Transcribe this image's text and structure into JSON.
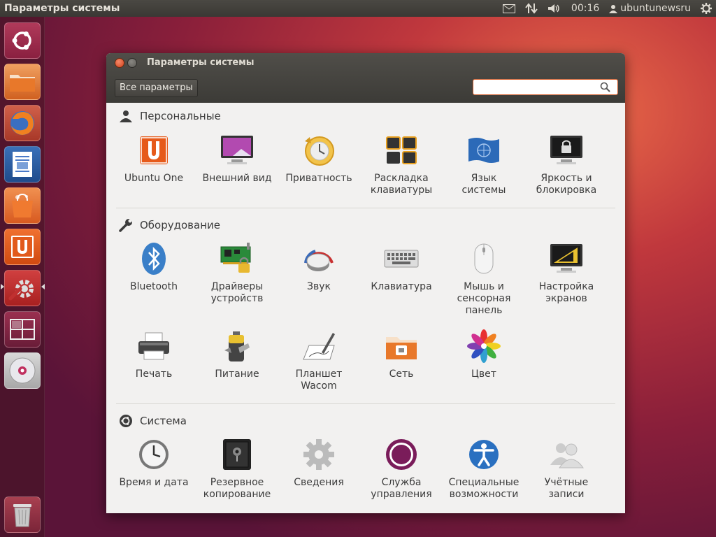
{
  "top_panel": {
    "app_title": "Параметры системы",
    "clock": "00:16",
    "user": "ubuntunewsru"
  },
  "launcher": {
    "items": [
      "dash-home",
      "files",
      "firefox",
      "libreoffice-writer",
      "ubuntu-software-center",
      "ubuntu-one",
      "system-settings",
      "workspace-switcher",
      "dvd",
      "trash"
    ]
  },
  "window": {
    "title": "Параметры системы",
    "all_settings_label": "Все параметры",
    "search_placeholder": ""
  },
  "sections": [
    {
      "title": "Персональные",
      "items": [
        {
          "label": "Ubuntu One"
        },
        {
          "label": "Внешний вид"
        },
        {
          "label": "Приватность"
        },
        {
          "label": "Раскладка\nклавиатуры"
        },
        {
          "label": "Язык\nсистемы"
        },
        {
          "label": "Яркость и\nблокировка"
        }
      ]
    },
    {
      "title": "Оборудование",
      "items": [
        {
          "label": "Bluetooth"
        },
        {
          "label": "Драйверы\nустройств"
        },
        {
          "label": "Звук"
        },
        {
          "label": "Клавиатура"
        },
        {
          "label": "Мышь и\nсенсорная\nпанель"
        },
        {
          "label": "Настройка\nэкранов"
        },
        {
          "label": "Печать"
        },
        {
          "label": "Питание"
        },
        {
          "label": "Планшет\nWacom"
        },
        {
          "label": "Сеть"
        },
        {
          "label": "Цвет"
        }
      ]
    },
    {
      "title": "Система",
      "items": [
        {
          "label": "Время и дата"
        },
        {
          "label": "Резервное\nкопирование"
        },
        {
          "label": "Сведения"
        },
        {
          "label": "Служба\nуправления"
        },
        {
          "label": "Специальные\nвозможности"
        },
        {
          "label": "Учётные\nзаписи"
        }
      ]
    }
  ],
  "colors": {
    "accent": "#dd4814",
    "panel": "#3c3b37",
    "window_bg": "#f2f1f0"
  }
}
